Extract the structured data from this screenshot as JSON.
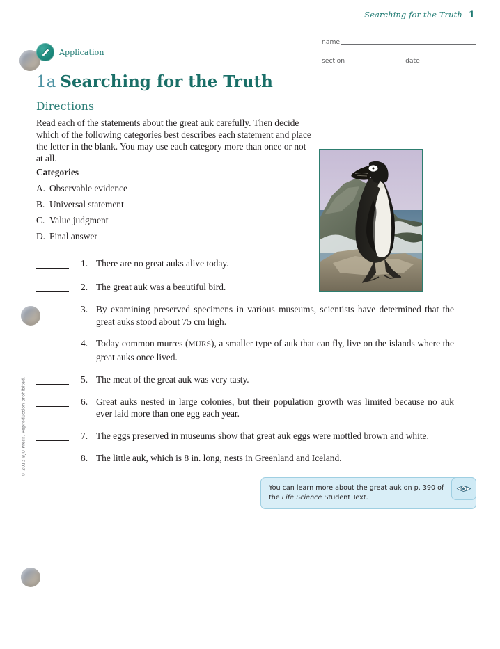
{
  "header": {
    "running_title": "Searching for the Truth",
    "page_number": "1"
  },
  "meta": {
    "name_label": "name",
    "section_label": "section",
    "date_label": "date"
  },
  "badge": {
    "label": "Application",
    "icon": "pencil-icon",
    "color": "#1d8a7d"
  },
  "title": {
    "number": "1a",
    "text": "Searching for the Truth",
    "number_color": "#4e93a3",
    "text_color": "#1a6f68"
  },
  "directions": {
    "heading": "Directions",
    "body": "Read each of the statements about the great auk carefully. Then decide which of the following categories best describes each statement and place the letter in the blank. You may use each category more than once or not at all."
  },
  "categories": {
    "heading": "Categories",
    "items": [
      {
        "letter": "A.",
        "label": "Observable evidence"
      },
      {
        "letter": "B.",
        "label": "Universal statement"
      },
      {
        "letter": "C.",
        "label": "Value judgment"
      },
      {
        "letter": "D.",
        "label": "Final answer"
      }
    ]
  },
  "figure": {
    "caption": "great-auk-illustration"
  },
  "questions": [
    {
      "number": "1.",
      "text": "There are no great auks alive today."
    },
    {
      "number": "2.",
      "text": "The great auk was a beautiful bird."
    },
    {
      "number": "3.",
      "text": "By examining preserved specimens in various museums, scientists have determined that the great auks stood about 75 cm high."
    },
    {
      "number": "4.",
      "text_before": "Today common murres (",
      "smallcaps": "MURS",
      "text_after": "), a smaller type of auk that can fly, live on the islands where the great auks once lived."
    },
    {
      "number": "5.",
      "text": "The meat of the great auk was very tasty."
    },
    {
      "number": "6.",
      "text": "Great auks nested in large colonies, but their population growth was limited because no auk ever laid more than one egg each year."
    },
    {
      "number": "7.",
      "text": "The eggs preserved in museums show that great auk eggs were mottled brown and white."
    },
    {
      "number": "8.",
      "text": "The little auk, which is 8 in. long, nests in Greenland and Iceland."
    }
  ],
  "callout": {
    "text_before": "You can learn more about the great auk on p. 390 of the ",
    "italic": "Life Science",
    "text_after": " Student Text.",
    "icon": "eye-icon",
    "background": "#d9eef7",
    "border": "#9fcfe2"
  },
  "copyright": "© 2013 BJU Press. Reproduction prohibited."
}
